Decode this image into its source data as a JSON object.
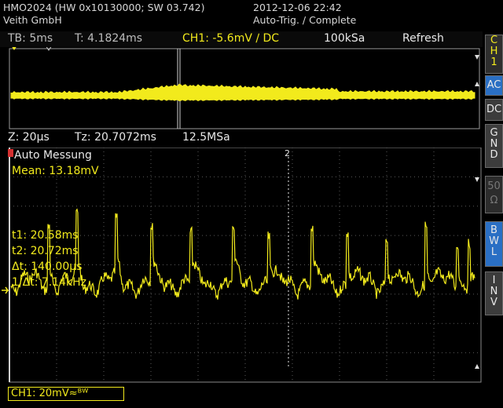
{
  "header": {
    "device": "HMO2024 (HW 0x10130000; SW 03.742)",
    "company": "Veith GmbH",
    "datetime": "2012-12-06 22:42",
    "trigger_status": "Auto-Trig. / Complete"
  },
  "status": {
    "timebase": "TB: 5ms",
    "trigger_time": "T: 4.1824ms",
    "channel_trigger": "CH1: -5.6mV ∕ DC",
    "sample_rate": "100kSa",
    "mode": "Refresh"
  },
  "zoom": {
    "zoom_timebase": "Z: 20µs",
    "zoom_time": "Tz: 20.7072ms",
    "zoom_rate": "12.5MSa"
  },
  "measurement": {
    "title": "Auto Messung",
    "mean": "Mean: 13.18mV",
    "t1": "t1: 20.58ms",
    "t2": "t2: 20.72ms",
    "delta_t": "Δt: 140.00µs",
    "inv_delta_t": "1/Δt: 7.14kHz",
    "cursor_marker": "2"
  },
  "sidebar": {
    "ch1": [
      "C",
      "H",
      "1"
    ],
    "ac": "AC",
    "dc": "DC",
    "gnd": [
      "G",
      "N",
      "D"
    ],
    "fifty_ohm": [
      "50",
      "Ω"
    ],
    "bwl": [
      "B",
      "W",
      "L"
    ],
    "inv": [
      "I",
      "N",
      "V"
    ]
  },
  "legend": {
    "channel": "CH1: 20mV≈ᴮᵂ"
  },
  "colors": {
    "trace": "#f2ea1c",
    "grid": "#5a5a5a",
    "sidebar_active": "#2a6fc4"
  }
}
